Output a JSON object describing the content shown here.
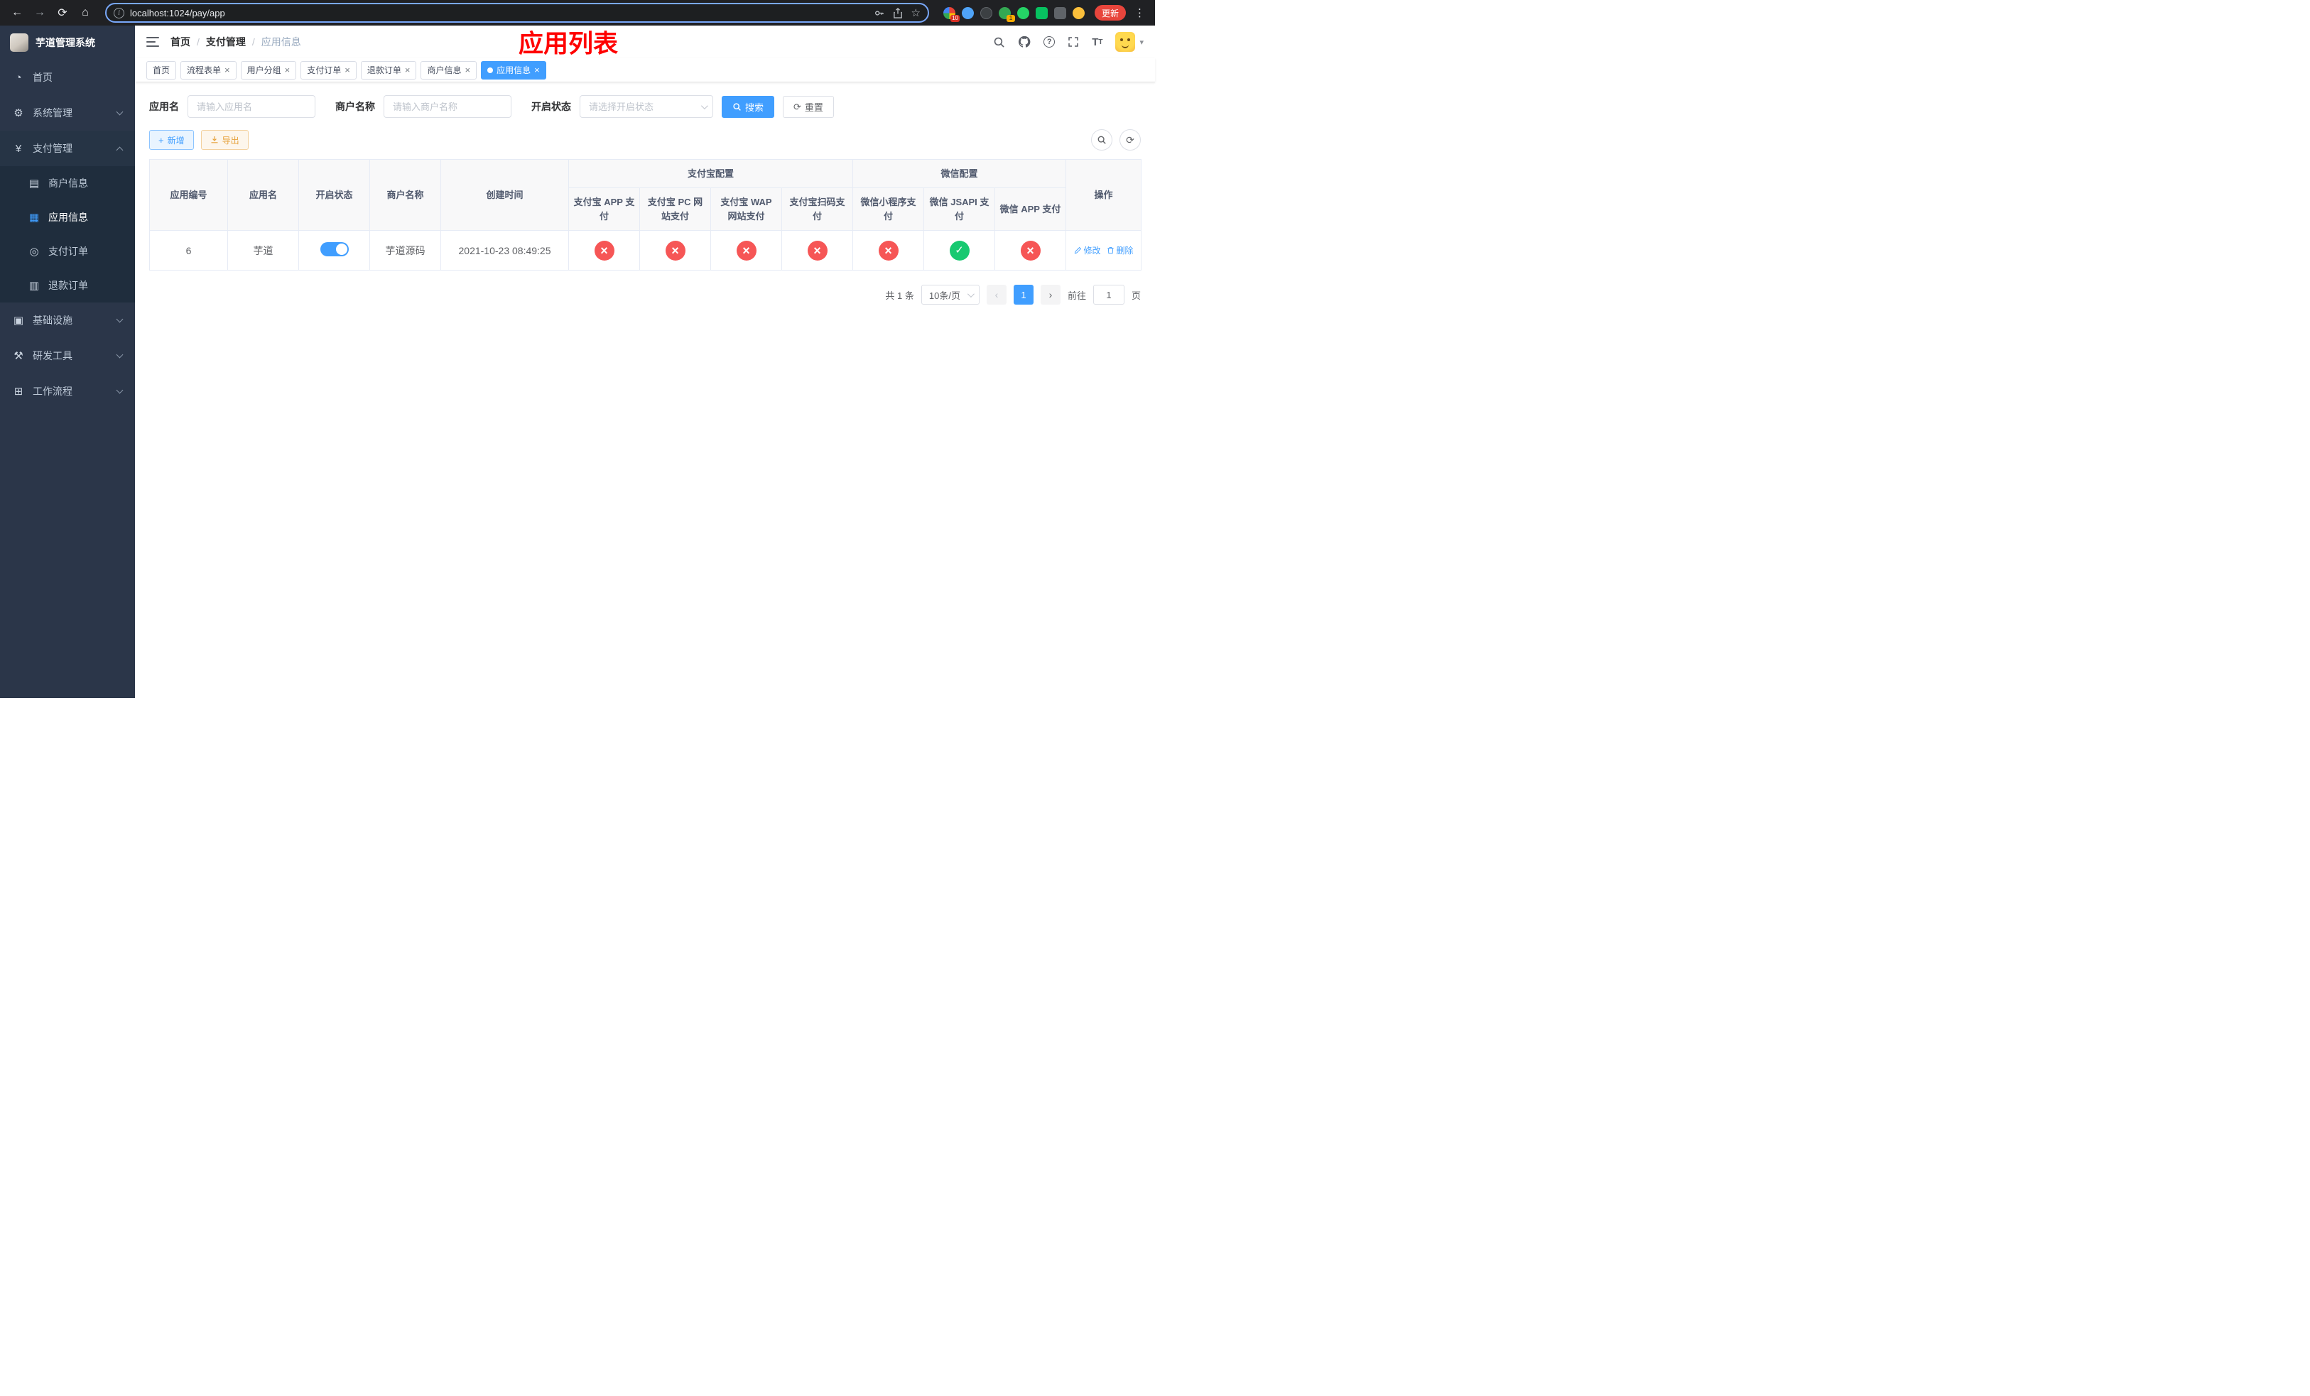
{
  "browser": {
    "url": "localhost:1024/pay/app",
    "update_button": "更新",
    "ext_badge_count": "10",
    "avatar_badge_count": "1"
  },
  "sidebar": {
    "app_title": "芋道管理系统",
    "menu": [
      {
        "label": "首页"
      },
      {
        "label": "系统管理"
      },
      {
        "label": "支付管理"
      },
      {
        "label": "基础设施"
      },
      {
        "label": "研发工具"
      },
      {
        "label": "工作流程"
      }
    ],
    "pay_submenu": [
      {
        "label": "商户信息"
      },
      {
        "label": "应用信息"
      },
      {
        "label": "支付订单"
      },
      {
        "label": "退款订单"
      }
    ]
  },
  "header": {
    "breadcrumb": [
      "首页",
      "支付管理",
      "应用信息"
    ],
    "annotation": "应用列表"
  },
  "tabs": [
    {
      "label": "首页"
    },
    {
      "label": "流程表单"
    },
    {
      "label": "用户分组"
    },
    {
      "label": "支付订单"
    },
    {
      "label": "退款订单"
    },
    {
      "label": "商户信息"
    },
    {
      "label": "应用信息"
    }
  ],
  "filters": {
    "app_name_label": "应用名",
    "app_name_placeholder": "请输入应用名",
    "merchant_label": "商户名称",
    "merchant_placeholder": "请输入商户名称",
    "status_label": "开启状态",
    "status_placeholder": "请选择开启状态",
    "search_label": "搜索",
    "reset_label": "重置"
  },
  "toolbar": {
    "add_label": "新增",
    "export_label": "导出"
  },
  "table": {
    "group_headers": {
      "alipay": "支付宝配置",
      "wechat": "微信配置"
    },
    "columns": [
      "应用编号",
      "应用名",
      "开启状态",
      "商户名称",
      "创建时间",
      "操作"
    ],
    "sub_columns": [
      "支付宝 APP 支付",
      "支付宝 PC 网站支付",
      "支付宝 WAP 网站支付",
      "支付宝扫码支付",
      "微信小程序支付",
      "微信 JSAPI 支付",
      "微信 APP 支付"
    ],
    "rows": [
      {
        "id": "6",
        "name": "芋道",
        "enabled": true,
        "merchant": "芋道源码",
        "created": "2021-10-23 08:49:25",
        "statuses": [
          "no",
          "no",
          "no",
          "no",
          "no",
          "yes",
          "no"
        ],
        "edit_label": "修改",
        "delete_label": "删除"
      }
    ]
  },
  "pagination": {
    "total_label": "共 1 条",
    "page_size": "10条/页",
    "current_page": "1",
    "goto_label": "前往",
    "goto_value": "1",
    "page_suffix": "页"
  },
  "colors": {
    "accent": "#409eff",
    "success": "#18c971",
    "danger": "#f65656",
    "warning": "#e6a23c",
    "annotation_red": "#ff0000",
    "sidebar_bg": "#2b3649",
    "submenu_bg": "#1f2d3d"
  }
}
